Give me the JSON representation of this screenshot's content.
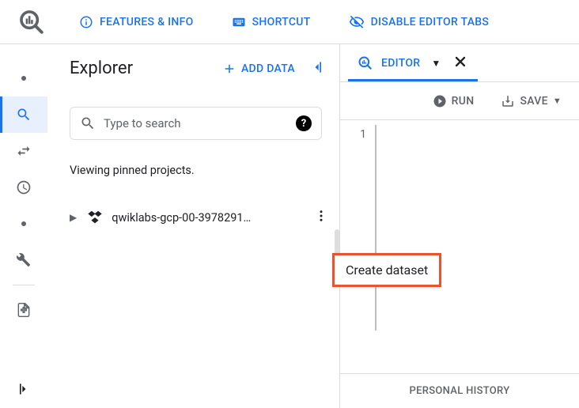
{
  "top": {
    "features": "FEATURES & INFO",
    "shortcut": "SHORTCUT",
    "disable_tabs": "DISABLE EDITOR TABS"
  },
  "explorer": {
    "title": "Explorer",
    "add_label": "ADD DATA",
    "search_placeholder": "Type to search",
    "viewing": "Viewing pinned projects.",
    "project_name": "qwiklabs-gcp-00-3978291…"
  },
  "popup": {
    "create_dataset": "Create dataset"
  },
  "editor": {
    "tab_label": "EDITOR",
    "run": "RUN",
    "save": "SAVE",
    "line_number": "1",
    "footer": "PERSONAL HISTORY"
  }
}
